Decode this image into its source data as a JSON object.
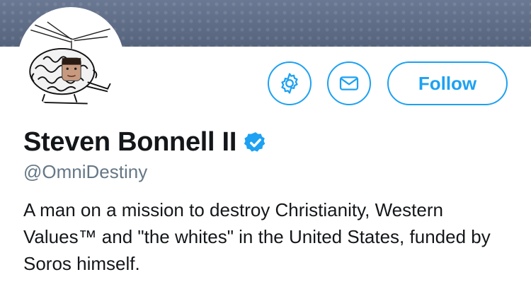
{
  "profile": {
    "name": "Steven Bonnell II",
    "handle": "@OmniDestiny",
    "bio": "A man on a mission to destroy Christianity, Western Values™ and \"the whites\" in the United States, funded by Soros himself.",
    "verified": true
  },
  "actions": {
    "follow_label": "Follow",
    "settings_icon": "gear-icon",
    "message_icon": "envelope-icon"
  },
  "colors": {
    "accent": "#1da1f2",
    "text": "#14171a",
    "muted": "#657786",
    "banner": "#5d6b86"
  }
}
